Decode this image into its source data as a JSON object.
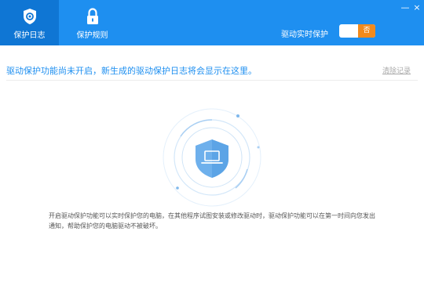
{
  "tabs": [
    {
      "label": "保护日志",
      "icon": "shield-gear-icon",
      "active": true
    },
    {
      "label": "保护规则",
      "icon": "lock-icon",
      "active": false
    }
  ],
  "realtime": {
    "label": "驱动实时保护",
    "state": "否"
  },
  "window": {
    "minimize": "—",
    "close": "×"
  },
  "main": {
    "message": "驱动保护功能尚未开启，新生成的驱动保护日志将会显示在这里。",
    "clear_link": "清除记录",
    "description": "开启驱动保护功能可以实时保护您的电脑，在其他程序试图安装或修改驱动时，驱动保护功能可以在第一时间向您发出通知，帮助保护您的电脑驱动不被破坏。"
  },
  "colors": {
    "accent": "#1e8ff0",
    "tab_active": "#0f76d4",
    "toggle_off": "#f28a1c"
  }
}
